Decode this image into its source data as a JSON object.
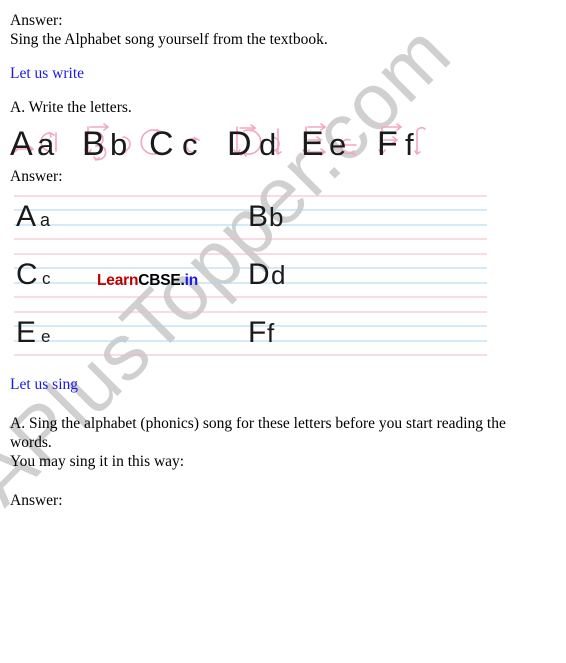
{
  "document": {
    "background_color": "#ffffff",
    "text_color": "#000000",
    "heading_color": "#1a1ae6"
  },
  "watermarks": {
    "diagonal": {
      "text": "APlusTopper.com",
      "color": "#d0d0d0",
      "rotation_deg": -45
    },
    "inline_logo": {
      "part1": "Learn",
      "part1_color": "#c00000",
      "part2": "CBSE.",
      "part2_color": "#000000",
      "part3": "in",
      "part3_color": "#1a1ae6"
    }
  },
  "content": {
    "answer_label_1": "Answer:",
    "answer_text_1": "Sing the Alphabet song yourself from the textbook.",
    "section_write_heading": "Let us write",
    "question_write": "A. Write the letters.",
    "answer_label_2": "Answer:",
    "section_sing_heading": "Let us sing",
    "question_sing_line1": "A. Sing the alphabet (phonics) song for these letters before you start reading the",
    "question_sing_line2": "words.",
    "question_sing_line3": "You may sing it in this way:",
    "answer_label_3": "Answer:"
  },
  "alphabet_guide": {
    "description": "Letters with pink stroke-order arrows",
    "stroke_arrow_color": "#f4a7c0",
    "letter_color": "#1a1a1a",
    "pairs": [
      {
        "upper": "A",
        "lower": "a"
      },
      {
        "upper": "B",
        "lower": "b"
      },
      {
        "upper": "C",
        "lower": "c"
      },
      {
        "upper": "D",
        "lower": "d"
      },
      {
        "upper": "E",
        "lower": "e"
      },
      {
        "upper": "F",
        "lower": "f"
      }
    ]
  },
  "writing_sheet": {
    "rule_color_outer": "#f2b8c6",
    "rule_color_inner": "#aad4ee",
    "letter_color": "#1a1a1a",
    "rows": [
      {
        "left": {
          "upper": "A",
          "lower": "a"
        },
        "right": {
          "upper": "B",
          "lower": "b"
        }
      },
      {
        "left": {
          "upper": "C",
          "lower": "c"
        },
        "right": {
          "upper": "D",
          "lower": "d"
        }
      },
      {
        "left": {
          "upper": "E",
          "lower": "e"
        },
        "right": {
          "upper": "F",
          "lower": "f"
        }
      }
    ]
  }
}
